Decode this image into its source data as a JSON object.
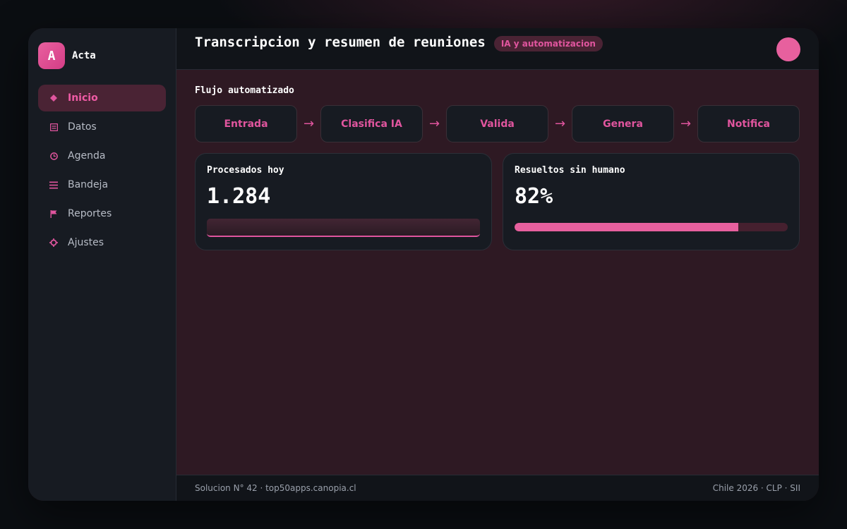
{
  "brand": {
    "logo_letter": "A",
    "name": "Acta"
  },
  "sidebar": {
    "items": [
      {
        "label": "Inicio",
        "icon": "diamond-icon",
        "active": true
      },
      {
        "label": "Datos",
        "icon": "database-icon",
        "active": false
      },
      {
        "label": "Agenda",
        "icon": "clock-icon",
        "active": false
      },
      {
        "label": "Bandeja",
        "icon": "inbox-list-icon",
        "active": false
      },
      {
        "label": "Reportes",
        "icon": "flag-icon",
        "active": false
      },
      {
        "label": "Ajustes",
        "icon": "gear-icon",
        "active": false
      }
    ]
  },
  "header": {
    "title": "Transcripcion y resumen de reuniones",
    "badge": "IA y automatizacion"
  },
  "flow": {
    "title": "Flujo automatizado",
    "steps": [
      "Entrada",
      "Clasifica IA",
      "Valida",
      "Genera",
      "Notifica"
    ],
    "arrow": "→"
  },
  "stats": {
    "processed": {
      "label": "Procesados hoy",
      "value": "1.284"
    },
    "resolved": {
      "label": "Resueltos sin humano",
      "value": "82%",
      "progress": 0.82
    }
  },
  "footer": {
    "left": "Solucion N° 42 · top50apps.canopia.cl",
    "right": "Chile 2026 · CLP · SII"
  },
  "colors": {
    "accent": "#e0559e",
    "background": "#2e1923",
    "panel": "#171b22"
  }
}
